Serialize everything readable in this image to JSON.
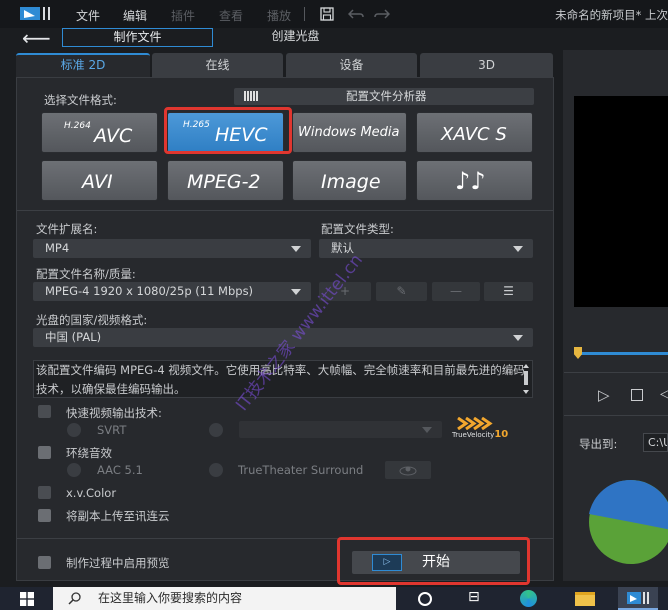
{
  "menu": {
    "file": "文件",
    "edit": "编辑",
    "plugins": "插件",
    "view": "查看",
    "playback": "播放",
    "project_title": "未命名的新项目* 上次"
  },
  "nav": {
    "tab_create": "制作文件",
    "tab_disc": "创建光盘"
  },
  "profile_tabs": [
    "标准 2D",
    "在线",
    "设备",
    "3D"
  ],
  "format": {
    "label": "选择文件格式:",
    "analyzer": "配置文件分析器",
    "buttons": [
      {
        "sup": "H.264",
        "main": "AVC"
      },
      {
        "sup": "H.265",
        "main": "HEVC"
      },
      {
        "sup": "",
        "main": "Windows Media"
      },
      {
        "sup": "",
        "main": "XAVC S"
      },
      {
        "sup": "",
        "main": "AVI"
      },
      {
        "sup": "",
        "main": "MPEG-2"
      },
      {
        "sup": "",
        "main": "Image"
      },
      {
        "sup": "",
        "main": "♪♪"
      }
    ]
  },
  "settings": {
    "ext_label": "文件扩展名:",
    "ext_value": "MP4",
    "profile_type_label": "配置文件类型:",
    "profile_type_value": "默认",
    "profile_name_label": "配置文件名称/质量:",
    "profile_name_value": "MPEG-4 1920 x 1080/25p (11 Mbps)",
    "country_label": "光盘的国家/视频格式:",
    "country_value": "中国 (PAL)",
    "description": "该配置文件编码 MPEG-4 视频文件。它使用高比特率、大帧幅、完全帧速率和目前最先进的编码技术，以确保最佳编码输出。"
  },
  "options": {
    "fast_render": "快速视频输出技术:",
    "svrt": "SVRT",
    "truevelocity": "TrueVelocity",
    "truevelocity_num": "10",
    "surround": "环绕音效",
    "aac": "AAC 5.1",
    "truetheater": "TrueTheater Surround",
    "xvcolor": "x.v.Color",
    "upload": "将副本上传至讯连云",
    "preview_while": "制作过程中启用预览",
    "start": "开始"
  },
  "right": {
    "export_label": "导出到:",
    "export_path": "C:\\U"
  },
  "taskbar": {
    "search_placeholder": "在这里输入你要搜索的内容"
  },
  "watermark": "IT技术之家 www.ittel.cn",
  "colors": {
    "accent": "#2f8bd4",
    "highlight": "#e0362f",
    "selected_format": "#3d8ed0"
  }
}
